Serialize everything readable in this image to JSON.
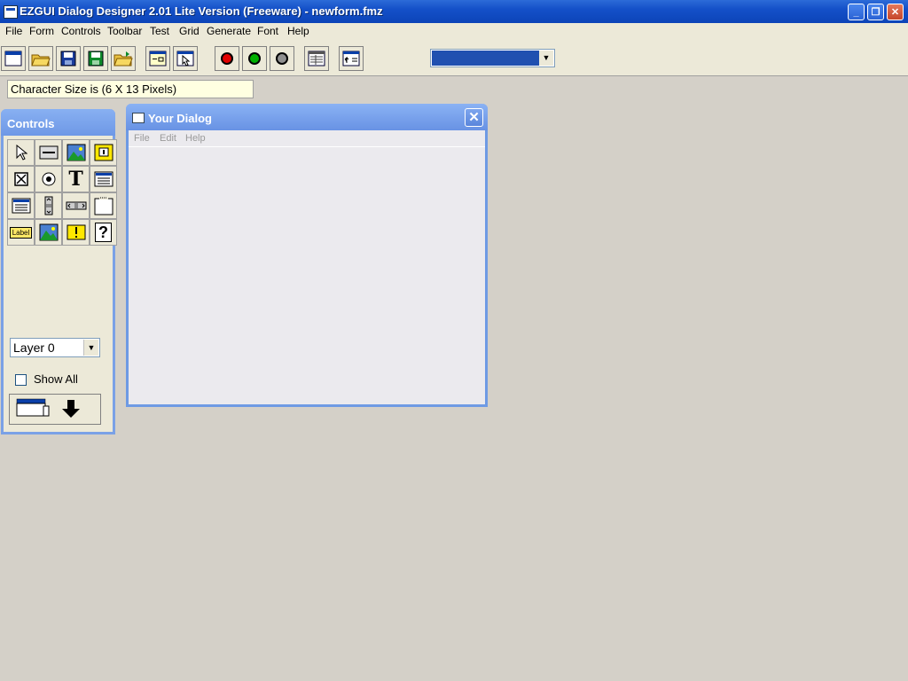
{
  "window": {
    "title": "EZGUI Dialog Designer 2.01 Lite Version (Freeware) - newform.fmz",
    "min_label": "_",
    "restore_label": "❐",
    "close_label": "✕"
  },
  "menu": [
    "File",
    "Form",
    "Controls",
    "Toolbar",
    "Test",
    "Grid",
    "Generate",
    "Font",
    "Help"
  ],
  "toolbar": {
    "buttons": [
      "new-form-icon",
      "open-icon",
      "save-icon",
      "save-as-icon",
      "open-folder-icon",
      "form-properties-icon",
      "select-tool-icon",
      "red-circle-icon",
      "green-circle-icon",
      "gray-circle-icon",
      "grid-window-icon",
      "import-icon"
    ],
    "color_combo_value": "#2050b0"
  },
  "status": {
    "char_size": "Character Size is  (6 X 13 Pixels)"
  },
  "controls_panel": {
    "title": "Controls",
    "tools": [
      "pointer-icon",
      "button-control-icon",
      "picture-control-icon",
      "frame-control-icon",
      "checkbox-control-icon",
      "radio-control-icon",
      "text-control-icon",
      "listbox-control-icon",
      "combobox-control-icon",
      "vscroll-control-icon",
      "hscroll-control-icon",
      "panel-control-icon",
      "label-control-icon",
      "image-control-icon",
      "alert-control-icon",
      "help-control-icon"
    ],
    "label_tool_text": "Label",
    "help_tool_text": "?",
    "text_tool_text": "T",
    "layer": "Layer  0",
    "show_all": "Show All"
  },
  "dialog": {
    "title": "Your Dialog",
    "menu": [
      "File",
      "Edit",
      "Help"
    ]
  }
}
